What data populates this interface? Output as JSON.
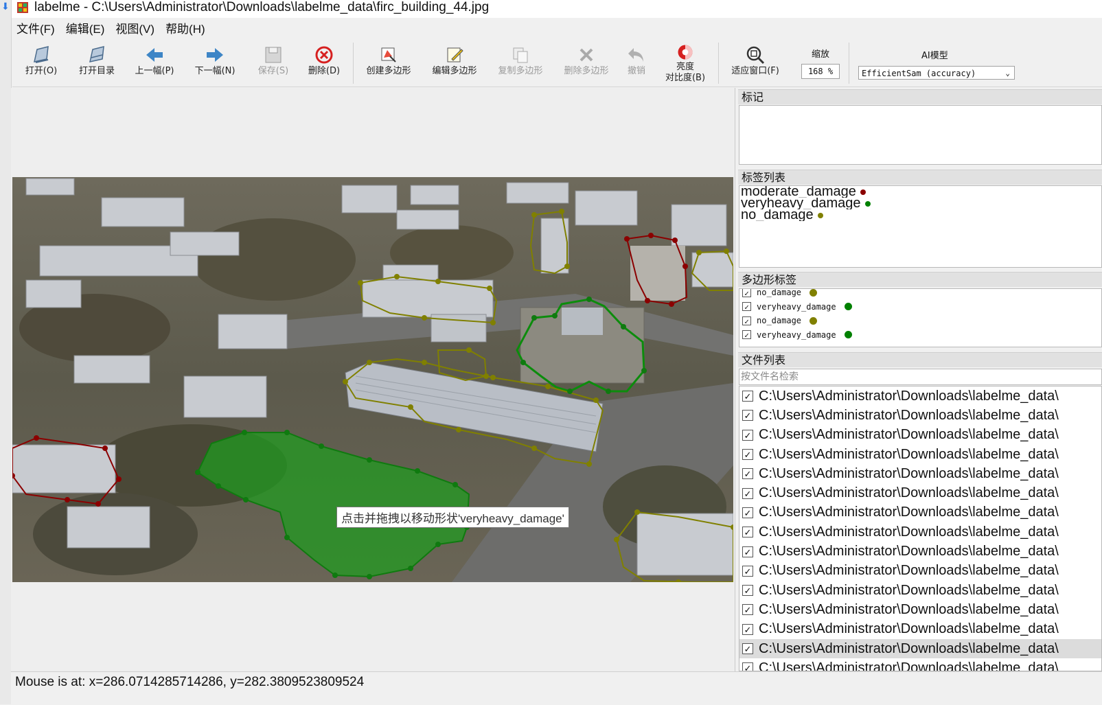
{
  "window": {
    "title": "labelme - C:\\Users\\Administrator\\Downloads\\labelme_data\\firc_building_44.jpg"
  },
  "menu": [
    "文件(F)",
    "编辑(E)",
    "视图(V)",
    "帮助(H)"
  ],
  "toolbar": {
    "open": "打开(O)",
    "open_dir": "打开目录",
    "prev": "上一幅(P)",
    "next": "下一幅(N)",
    "save": "保存(S)",
    "delete": "删除(D)",
    "create_polygon": "创建多边形",
    "edit_polygon": "编辑多边形",
    "copy_polygon": "复制多边形",
    "delete_polygon": "删除多边形",
    "undo": "撤销",
    "brightness_line1": "亮度",
    "brightness_line2": "对比度(B)",
    "fit_window": "适应窗口(F)",
    "zoom_label": "缩放",
    "zoom_value": "168 %",
    "ai_label": "AI模型",
    "ai_model": "EfficientSam (accuracy)"
  },
  "canvas": {
    "tooltip": "点击并拖拽以移动形状'veryheavy_damage'"
  },
  "colors": {
    "moderate_damage": "#8b0000",
    "veryheavy_damage": "#008000",
    "no_damage": "#808000"
  },
  "panels": {
    "flags_title": "标记",
    "labels_title": "标签列表",
    "labels": [
      {
        "name": "moderate_damage",
        "color": "#8b0000"
      },
      {
        "name": "veryheavy_damage",
        "color": "#008000"
      },
      {
        "name": "no_damage",
        "color": "#808000"
      }
    ],
    "polygons_title": "多边形标签",
    "polygons": [
      {
        "name": "no_damage",
        "color": "#808000"
      },
      {
        "name": "veryheavy_damage",
        "color": "#008000"
      },
      {
        "name": "no_damage",
        "color": "#808000"
      },
      {
        "name": "veryheavy_damage",
        "color": "#008000"
      }
    ],
    "files_title": "文件列表",
    "file_search_placeholder": "按文件名检索",
    "files": [
      "C:\\Users\\Administrator\\Downloads\\labelme_data\\",
      "C:\\Users\\Administrator\\Downloads\\labelme_data\\",
      "C:\\Users\\Administrator\\Downloads\\labelme_data\\",
      "C:\\Users\\Administrator\\Downloads\\labelme_data\\",
      "C:\\Users\\Administrator\\Downloads\\labelme_data\\",
      "C:\\Users\\Administrator\\Downloads\\labelme_data\\",
      "C:\\Users\\Administrator\\Downloads\\labelme_data\\",
      "C:\\Users\\Administrator\\Downloads\\labelme_data\\",
      "C:\\Users\\Administrator\\Downloads\\labelme_data\\",
      "C:\\Users\\Administrator\\Downloads\\labelme_data\\",
      "C:\\Users\\Administrator\\Downloads\\labelme_data\\",
      "C:\\Users\\Administrator\\Downloads\\labelme_data\\",
      "C:\\Users\\Administrator\\Downloads\\labelme_data\\",
      "C:\\Users\\Administrator\\Downloads\\labelme_data\\",
      "C:\\Users\\Administrator\\Downloads\\labelme_data\\"
    ],
    "selected_file_index": 13
  },
  "status": {
    "text": "Mouse is at: x=286.0714285714286, y=282.3809523809524"
  }
}
